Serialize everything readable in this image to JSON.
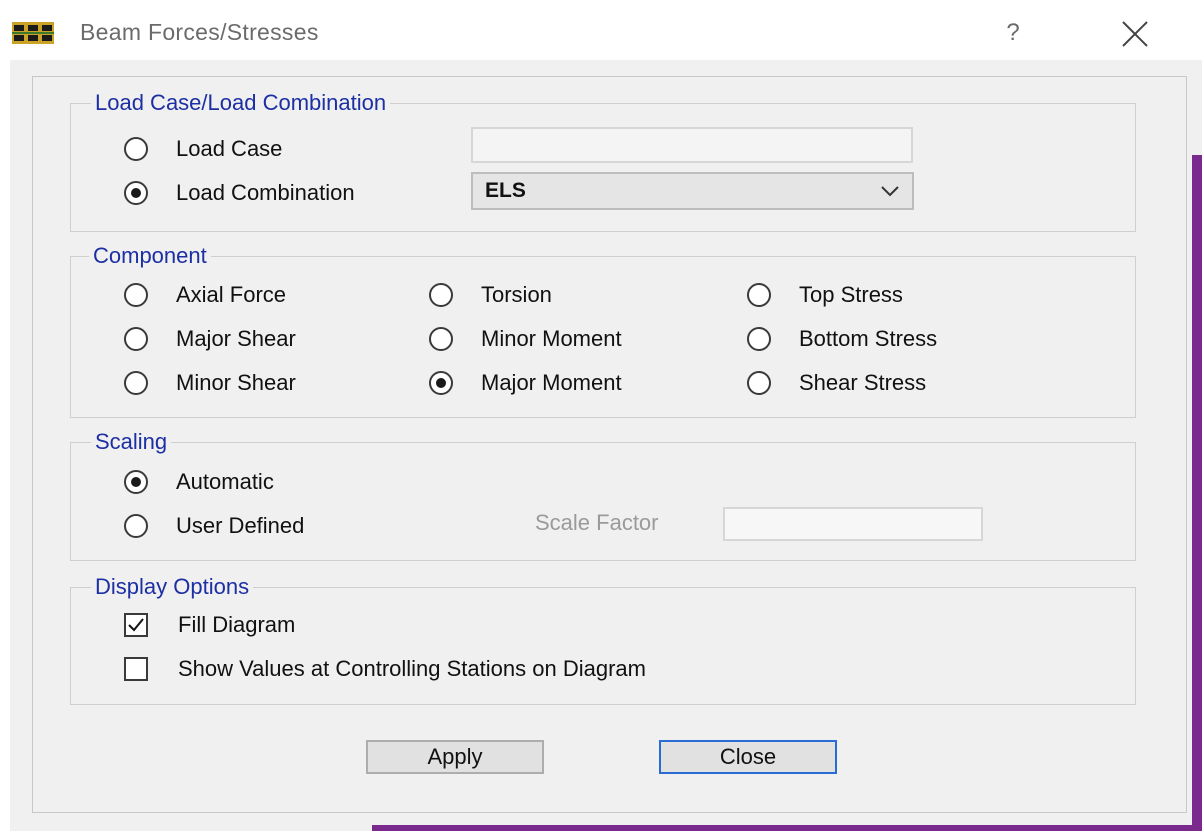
{
  "window": {
    "title": "Beam Forces/Stresses",
    "help_label": "?",
    "app_icon": "beam-app-icon",
    "close_icon": "close-icon"
  },
  "load_group": {
    "legend": "Load Case/Load Combination",
    "load_case": {
      "label": "Load Case",
      "selected": false,
      "value": ""
    },
    "load_combination": {
      "label": "Load Combination",
      "selected": true,
      "value": "ELS"
    }
  },
  "component_group": {
    "legend": "Component",
    "options": [
      {
        "label": "Axial Force",
        "selected": false
      },
      {
        "label": "Major Shear",
        "selected": false
      },
      {
        "label": "Minor Shear",
        "selected": false
      },
      {
        "label": "Torsion",
        "selected": false
      },
      {
        "label": "Minor Moment",
        "selected": false
      },
      {
        "label": "Major Moment",
        "selected": true
      },
      {
        "label": "Top Stress",
        "selected": false
      },
      {
        "label": "Bottom Stress",
        "selected": false
      },
      {
        "label": "Shear Stress",
        "selected": false
      }
    ]
  },
  "scaling_group": {
    "legend": "Scaling",
    "automatic": {
      "label": "Automatic",
      "selected": true
    },
    "user_defined": {
      "label": "User Defined",
      "selected": false
    },
    "scale_factor_label": "Scale Factor",
    "scale_factor_value": ""
  },
  "display_group": {
    "legend": "Display Options",
    "fill_diagram": {
      "label": "Fill Diagram",
      "checked": true
    },
    "show_values": {
      "label": "Show Values at Controlling Stations on Diagram",
      "checked": false
    }
  },
  "buttons": {
    "apply": "Apply",
    "close": "Close"
  },
  "colors": {
    "legend_text": "#1c2fa3",
    "dialog_bg": "#f0f0f0",
    "default_button_border": "#2a6bd4",
    "background_window_accent": "#7a2a8c"
  }
}
